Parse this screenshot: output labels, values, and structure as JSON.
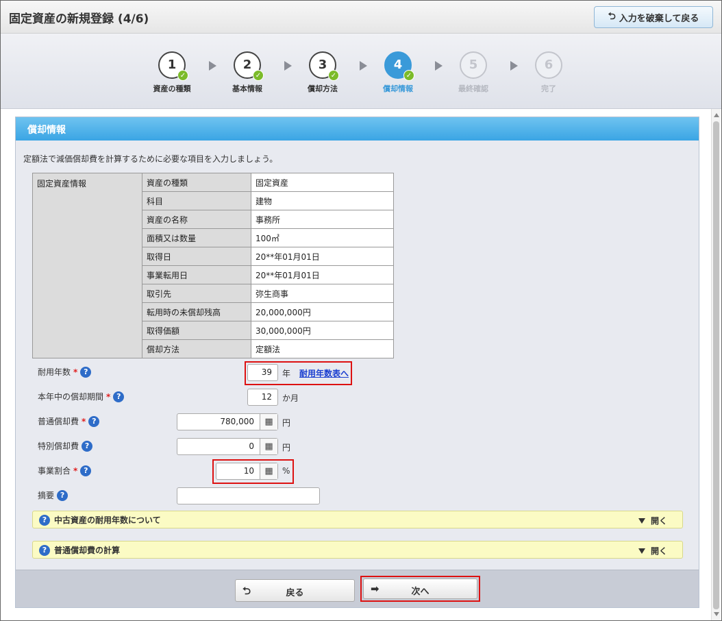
{
  "window": {
    "title": "固定資産の新規登録 (4/6)",
    "discard_label": "入力を破棄して戻る"
  },
  "steps": [
    {
      "number": "1",
      "label": "資産の種類",
      "state": "done"
    },
    {
      "number": "2",
      "label": "基本情報",
      "state": "done"
    },
    {
      "number": "3",
      "label": "償却方法",
      "state": "done"
    },
    {
      "number": "4",
      "label": "償却情報",
      "state": "active"
    },
    {
      "number": "5",
      "label": "最終確認",
      "state": "future"
    },
    {
      "number": "6",
      "label": "完了",
      "state": "future"
    }
  ],
  "panel": {
    "title": "償却情報",
    "intro": "定額法で減価償却費を計算するために必要な項目を入力しましょう。"
  },
  "info_table": {
    "group_label": "固定資産情報",
    "rows": [
      {
        "key": "資産の種類",
        "value": "固定資産"
      },
      {
        "key": "科目",
        "value": "建物"
      },
      {
        "key": "資産の名称",
        "value": "事務所"
      },
      {
        "key": "面積又は数量",
        "value": "100㎡"
      },
      {
        "key": "取得日",
        "value": "20**年01月01日"
      },
      {
        "key": "事業転用日",
        "value": "20**年01月01日"
      },
      {
        "key": "取引先",
        "value": "弥生商事"
      },
      {
        "key": "転用時の未償却残高",
        "value": "20,000,000円"
      },
      {
        "key": "取得価額",
        "value": "30,000,000円"
      },
      {
        "key": "償却方法",
        "value": "定額法"
      }
    ]
  },
  "form": {
    "useful_life": {
      "label": "耐用年数",
      "value": "39",
      "unit": "年",
      "link": "耐用年数表へ"
    },
    "months": {
      "label": "本年中の償却期間",
      "value": "12",
      "unit": "か月"
    },
    "normal_depr": {
      "label": "普通償却費",
      "value": "780,000",
      "unit": "円"
    },
    "special_depr": {
      "label": "特別償却費",
      "value": "0",
      "unit": "円"
    },
    "business_ratio": {
      "label": "事業割合",
      "value": "10",
      "unit": "%"
    },
    "memo": {
      "label": "摘要",
      "value": ""
    }
  },
  "accordions": [
    {
      "title": "中古資産の耐用年数について",
      "toggle": "開く"
    },
    {
      "title": "普通償却費の計算",
      "toggle": "開く"
    }
  ],
  "footer": {
    "back_label": "戻る",
    "next_label": "次へ"
  },
  "colors": {
    "accent": "#3a9ad9",
    "highlight": "#d11111",
    "header": "#3aa5e4"
  }
}
